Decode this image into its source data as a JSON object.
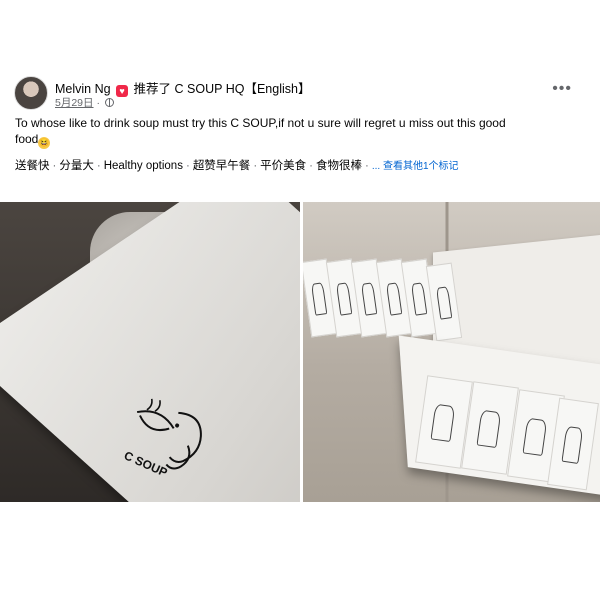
{
  "post": {
    "author": "Melvin Ng",
    "recommend_text": "推荐了",
    "page_name": "C SOUP HQ【English】",
    "date": "5月29日",
    "meta_separator": "·",
    "text": "To whose like to drink soup must try this C SOUP,if not u sure will regret u miss out this good food",
    "emoji": "😆",
    "tags": [
      "送餐快",
      "分量大",
      "Healthy options",
      "超赞早午餐",
      "平价美食",
      "食物很棒"
    ],
    "tag_separator": "·",
    "see_more": "... 查看其他1个标记",
    "more_menu": "•••"
  },
  "photos": {
    "left": {
      "logo_text": "C SOUP"
    }
  },
  "colors": {
    "link": "#0064d1",
    "secondary_text": "#65676b",
    "recommend_badge": "#f02849"
  },
  "icons": {
    "recommend": "heart-badge-icon",
    "privacy": "globe-icon",
    "more": "more-options-icon"
  }
}
